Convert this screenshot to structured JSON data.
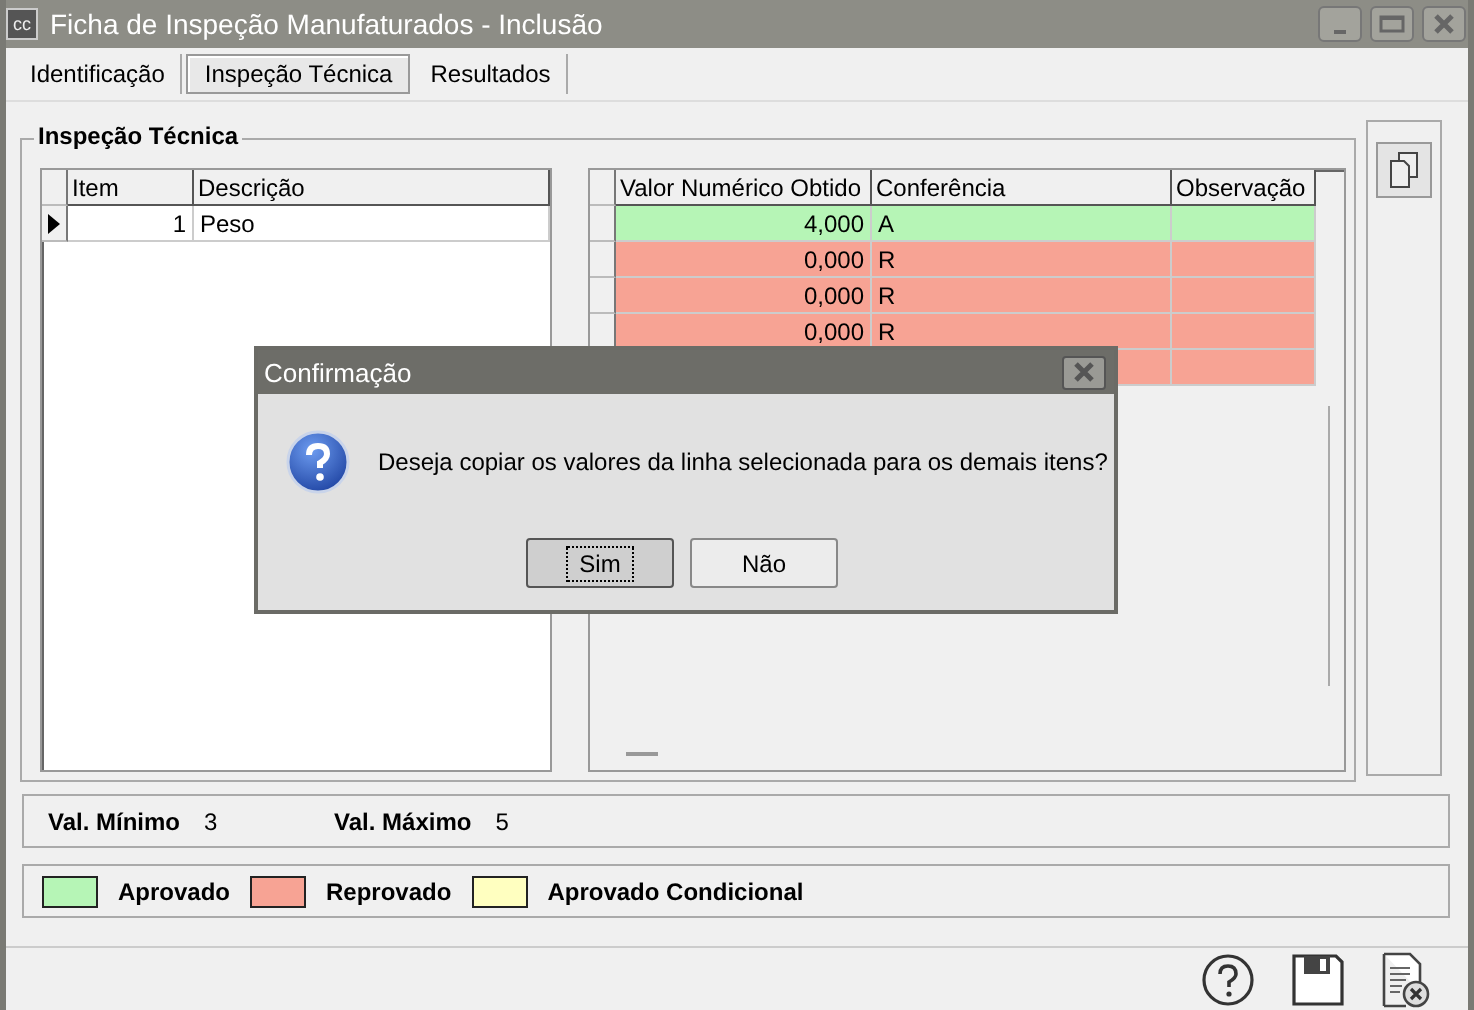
{
  "window": {
    "icon_text": "cc",
    "title": "Ficha de Inspeção Manufaturados - Inclusão"
  },
  "tabs": [
    {
      "label": "Identificação",
      "selected": false
    },
    {
      "label": "Inspeção Técnica",
      "selected": true
    },
    {
      "label": "Resultados",
      "selected": false
    }
  ],
  "group_title": "Inspeção Técnica",
  "items_table": {
    "columns": [
      "Item",
      "Descrição"
    ],
    "rows": [
      {
        "item": "1",
        "descricao": "Peso",
        "selected": true
      }
    ]
  },
  "results_table": {
    "columns": [
      "Valor Numérico Obtido",
      "Conferência",
      "Observação"
    ],
    "rows": [
      {
        "valor": "4,000",
        "conferencia": "A",
        "color": "#b6f5b6"
      },
      {
        "valor": "0,000",
        "conferencia": "R",
        "color": "#f7a394"
      },
      {
        "valor": "0,000",
        "conferencia": "R",
        "color": "#f7a394"
      },
      {
        "valor": "0,000",
        "conferencia": "R",
        "color": "#f7a394"
      },
      {
        "color": "#f7a394"
      }
    ]
  },
  "limits": [
    {
      "label": "Val. Mínimo",
      "value": "3"
    },
    {
      "label": "Val. Máximo",
      "value": "5"
    }
  ],
  "legend": [
    {
      "label": "Aprovado",
      "color": "#b6f5b6"
    },
    {
      "label": "Reprovado",
      "color": "#f7a394"
    },
    {
      "label": "Aprovado Condicional",
      "color": "#ffffc0"
    }
  ],
  "dialog": {
    "title": "Confirmação",
    "message": "Deseja copiar os valores da linha selecionada para os demais itens?",
    "buttons": [
      {
        "label": "Sim",
        "focused": true
      },
      {
        "label": "Não",
        "focused": false
      }
    ]
  }
}
